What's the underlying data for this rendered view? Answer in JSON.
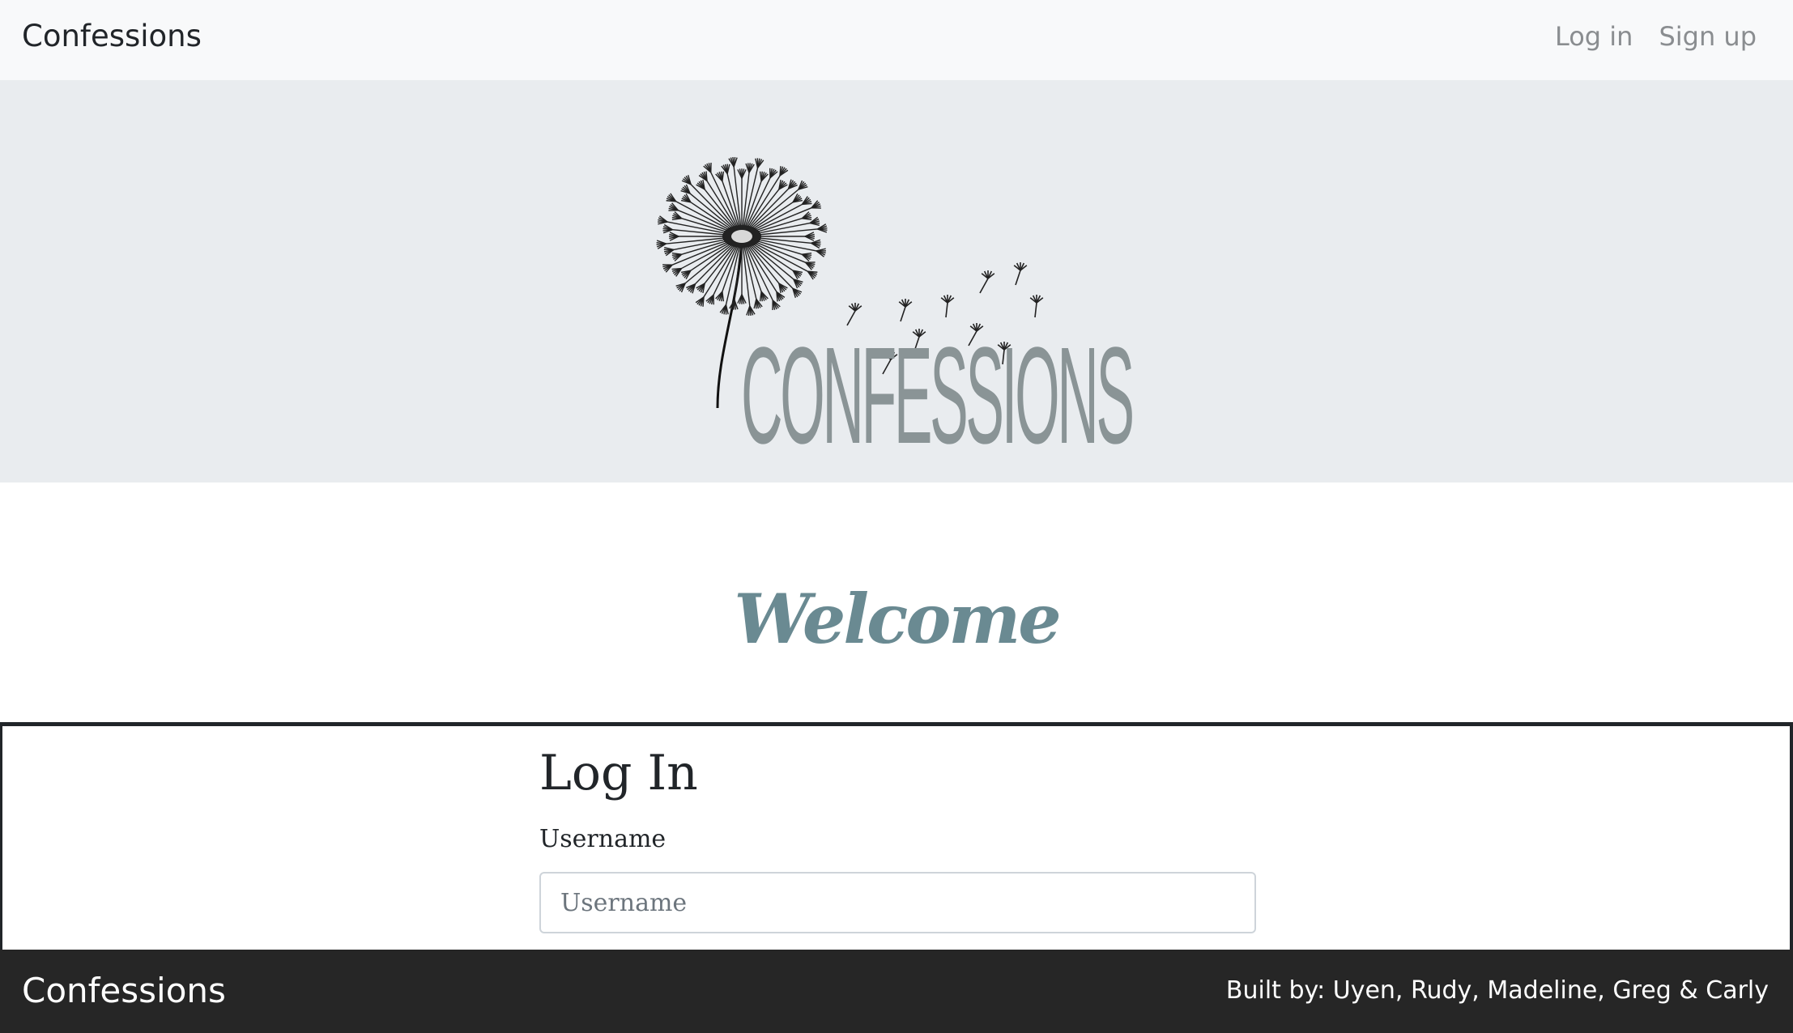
{
  "navbar": {
    "brand": "Confessions",
    "links": [
      "Log in",
      "Sign up"
    ]
  },
  "hero": {
    "logo_text": "CONFESSIONS",
    "logo_icon": "dandelion-icon"
  },
  "welcome": {
    "heading": "Welcome"
  },
  "login": {
    "title": "Log In",
    "username_label": "Username",
    "username_placeholder": "Username"
  },
  "footer": {
    "brand": "Confessions",
    "credits": "Built by: Uyen, Rudy, Madeline, Greg & Carly"
  },
  "colors": {
    "navbar_bg": "#f8f9fa",
    "hero_bg": "#e9ecef",
    "welcome_accent": "#6a8a92",
    "footer_bg": "#262626"
  }
}
